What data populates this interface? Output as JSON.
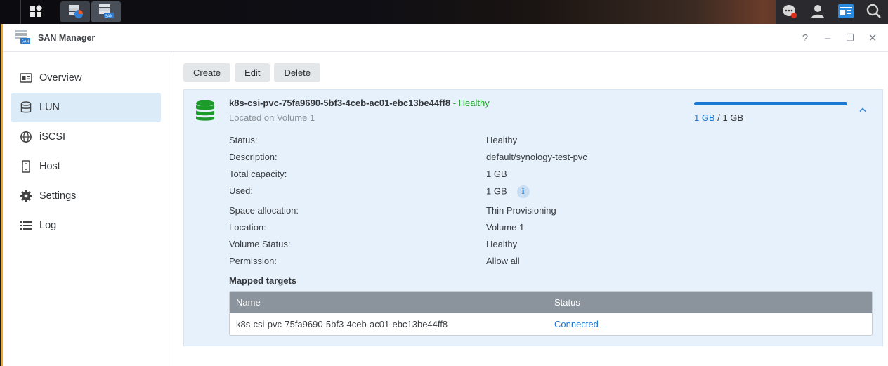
{
  "taskbar": {
    "main_menu_icon": "grid-icon",
    "apps": [
      {
        "name": "storage-manager",
        "icon": "storage-app-icon"
      },
      {
        "name": "san-manager",
        "icon": "san-app-icon"
      }
    ],
    "right_icons": [
      "chat-notification-icon",
      "user-icon",
      "widgets-icon",
      "search-icon"
    ]
  },
  "window": {
    "title": "SAN Manager",
    "controls": {
      "help": "?",
      "minimize": "–",
      "restore": "❐",
      "close": "✕"
    }
  },
  "sidebar": {
    "items": [
      {
        "label": "Overview",
        "icon": "overview-icon",
        "active": false
      },
      {
        "label": "LUN",
        "icon": "database-icon",
        "active": true
      },
      {
        "label": "iSCSI",
        "icon": "globe-icon",
        "active": false
      },
      {
        "label": "Host",
        "icon": "host-icon",
        "active": false
      },
      {
        "label": "Settings",
        "icon": "gear-icon",
        "active": false
      },
      {
        "label": "Log",
        "icon": "list-icon",
        "active": false
      }
    ]
  },
  "toolbar": {
    "create": "Create",
    "edit": "Edit",
    "delete": "Delete"
  },
  "lun": {
    "name": "k8s-csi-pvc-75fa9690-5bf3-4ceb-ac01-ebc13be44ff8",
    "status_suffix": "- Healthy",
    "location_text": "Located on Volume 1",
    "capacity_used": "1 GB",
    "capacity_sep": " / ",
    "capacity_total": "1 GB",
    "usage_fraction": 1.0,
    "details": {
      "status_label": "Status:",
      "status_value": "Healthy",
      "description_label": "Description:",
      "description_value": "default/synology-test-pvc",
      "total_label": "Total capacity:",
      "total_value": "1 GB",
      "used_label": "Used:",
      "used_value": "1 GB",
      "used_info": "i",
      "alloc_label": "Space allocation:",
      "alloc_value": "Thin Provisioning",
      "location_label": "Location:",
      "location_value": "Volume 1",
      "volstatus_label": "Volume Status:",
      "volstatus_value": "Healthy",
      "permission_label": "Permission:",
      "permission_value": "Allow all"
    },
    "mapped_title": "Mapped targets",
    "targets": {
      "headers": {
        "name": "Name",
        "status": "Status"
      },
      "rows": [
        {
          "name": "k8s-csi-pvc-75fa9690-5bf3-4ceb-ac01-ebc13be44ff8",
          "status": "Connected"
        }
      ]
    }
  },
  "colors": {
    "accent": "#1d78d4",
    "healthy": "#1fa12a",
    "selected_bg": "#dcebf8",
    "panel_bg": "#e6f1fb"
  }
}
